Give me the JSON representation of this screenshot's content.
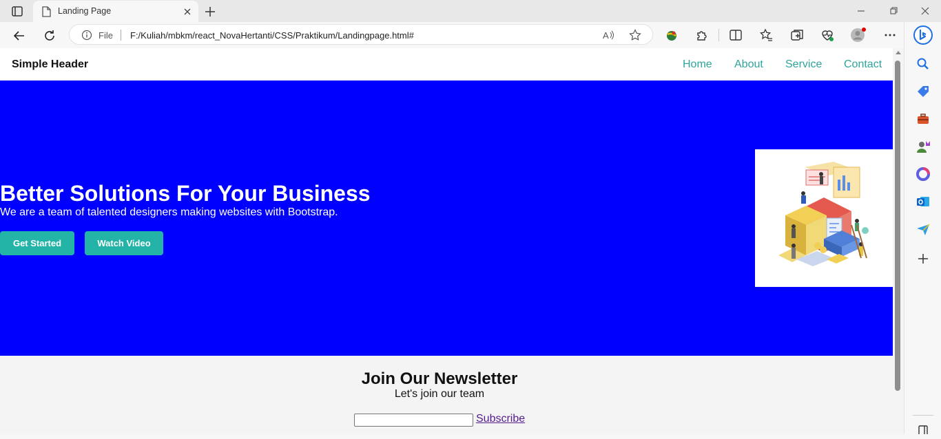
{
  "browser": {
    "tab_title": "Landing Page",
    "omnibox_scheme_label": "File",
    "omnibox_url": "F:/Kuliah/mbkm/react_NovaHertanti/CSS/Praktikum/Landingpage.html#"
  },
  "page": {
    "header": {
      "brand": "Simple Header",
      "nav": [
        "Home",
        "About",
        "Service",
        "Contact"
      ]
    },
    "hero": {
      "title": "Better Solutions For Your Business",
      "subtitle": "We are a team of talented designers making websites with Bootstrap.",
      "primary_button": "Get Started",
      "secondary_button": "Watch Video",
      "background_color": "#0000ff",
      "button_color": "#24b3a7"
    },
    "newsletter": {
      "title": "Join Our Newsletter",
      "subtitle": "Let's join our team",
      "input_value": "",
      "subscribe_label": "Subscribe"
    },
    "colors": {
      "nav_link": "#2fa59a",
      "visited_link": "#551a8b"
    }
  },
  "icons": {
    "tabbar": [
      "tab-actions-icon",
      "page-favicon-icon",
      "close-tab-icon",
      "new-tab-icon",
      "minimize-icon",
      "restore-icon",
      "close-window-icon"
    ],
    "toolbar": [
      "back-icon",
      "refresh-icon",
      "info-icon",
      "read-aloud-icon",
      "favorite-star-icon",
      "extension-globe-icon",
      "extensions-puzzle-icon",
      "split-screen-icon",
      "favorites-icon",
      "collections-icon",
      "performance-icon",
      "profile-avatar-icon",
      "more-menu-icon",
      "copilot-icon"
    ],
    "sidebar": [
      "search-icon",
      "shopping-tag-icon",
      "tools-briefcase-icon",
      "games-icon",
      "office-icon",
      "outlook-icon",
      "drop-send-icon",
      "add-icon",
      "sidebar-toggle-icon"
    ]
  }
}
